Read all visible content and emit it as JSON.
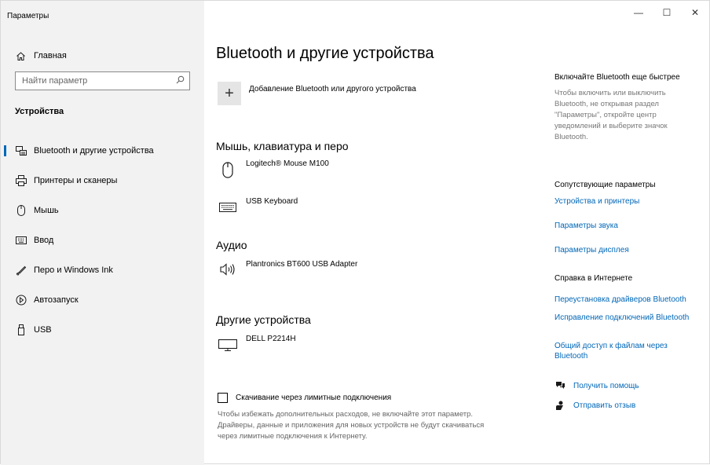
{
  "app": {
    "title": "Параметры"
  },
  "window_controls": {
    "minimize": "—",
    "maximize": "☐",
    "close": "✕"
  },
  "sidebar": {
    "home_label": "Главная",
    "search_placeholder": "Найти параметр",
    "section_title": "Устройства",
    "items": [
      {
        "label": "Bluetooth и другие устройства",
        "icon": "bluetooth-devices-icon",
        "active": true
      },
      {
        "label": "Принтеры и сканеры",
        "icon": "printer-icon"
      },
      {
        "label": "Мышь",
        "icon": "mouse-icon"
      },
      {
        "label": "Ввод",
        "icon": "keyboard-icon"
      },
      {
        "label": "Перо и Windows Ink",
        "icon": "pen-icon"
      },
      {
        "label": "Автозапуск",
        "icon": "autoplay-icon"
      },
      {
        "label": "USB",
        "icon": "usb-icon"
      }
    ]
  },
  "main": {
    "title": "Bluetooth и другие устройства",
    "add_device_label": "Добавление Bluetooth или другого устройства",
    "groups": [
      {
        "title": "Мышь, клавиатура и перо",
        "devices": [
          {
            "name": "Logitech® Mouse M100",
            "icon": "mouse-icon"
          },
          {
            "name": "USB Keyboard",
            "icon": "keyboard-icon"
          }
        ]
      },
      {
        "title": "Аудио",
        "devices": [
          {
            "name": "Plantronics BT600 USB Adapter",
            "icon": "speaker-icon"
          }
        ]
      },
      {
        "title": "Другие устройства",
        "devices": [
          {
            "name": "DELL P2214H",
            "icon": "monitor-icon"
          }
        ]
      }
    ],
    "metered": {
      "label": "Скачивание через лимитные подключения",
      "checked": false,
      "description": "Чтобы избежать дополнительных расходов, не включайте этот параметр. Драйверы, данные и приложения для новых устройств не будут скачиваться через лимитные подключения к Интернету."
    }
  },
  "right": {
    "quick_title": "Включайте Bluetooth еще быстрее",
    "quick_desc": "Чтобы включить или выключить Bluetooth, не открывая раздел \"Параметры\", откройте центр уведомлений и выберите значок Bluetooth.",
    "related_title": "Сопутствующие параметры",
    "related_links": [
      "Устройства и принтеры",
      "Параметры звука",
      "Параметры дисплея"
    ],
    "web_help_title": "Справка в Интернете",
    "web_links": [
      "Переустановка драйверов Bluetooth",
      "Исправление подключений Bluetooth",
      "Общий доступ к файлам через Bluetooth"
    ],
    "get_help": "Получить помощь",
    "feedback": "Отправить отзыв"
  },
  "colors": {
    "accent": "#0067b8",
    "sidebar_bg": "#f2f2f2",
    "secondary_text": "#777777"
  }
}
